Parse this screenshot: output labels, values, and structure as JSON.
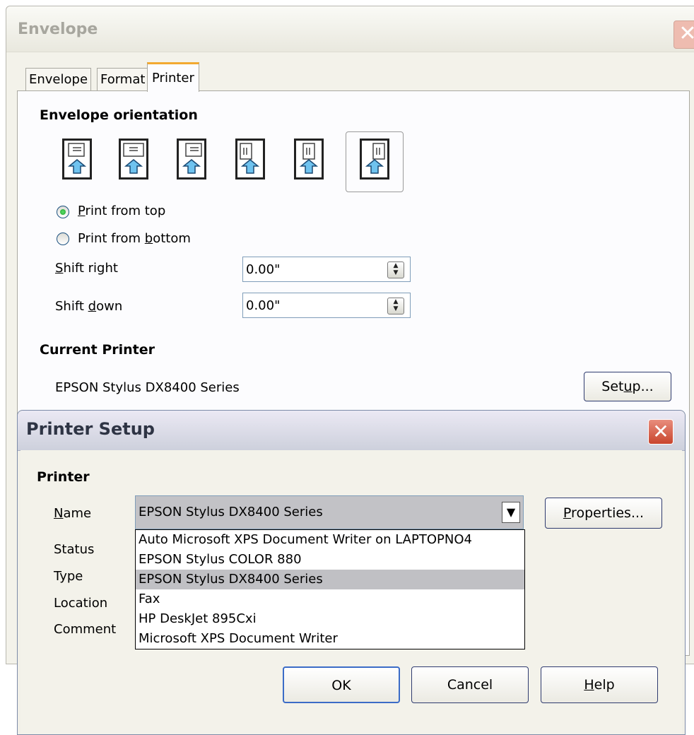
{
  "envelope_dialog": {
    "title": "Envelope",
    "tabs": [
      "Envelope",
      "Format",
      "Printer"
    ],
    "active_tab": "Printer",
    "orientation_heading": "Envelope orientation",
    "orientation_icons": [
      "horizontal-left",
      "horizontal-center",
      "horizontal-right",
      "vertical-left",
      "vertical-center",
      "vertical-right"
    ],
    "selected_orientation_index": 5,
    "print_from_top": {
      "label_key": "P",
      "label_rest": "rint from top",
      "checked": true
    },
    "print_from_bottom": {
      "label_pre": "Print from ",
      "label_key": "b",
      "label_rest": "ottom",
      "checked": false
    },
    "shift_right": {
      "label_key": "S",
      "label_rest": "hift right",
      "value": "0.00\""
    },
    "shift_down": {
      "label_pre": "Shift ",
      "label_key": "d",
      "label_rest": "own",
      "value": "0.00\""
    },
    "current_printer_heading": "Current Printer",
    "current_printer_name": "EPSON Stylus DX8400 Series",
    "setup_button": {
      "pre": "Set",
      "key": "u",
      "rest": "p..."
    }
  },
  "printer_setup_dialog": {
    "title": "Printer Setup",
    "printer_heading": "Printer",
    "name_label": {
      "key": "N",
      "rest": "ame"
    },
    "name_value": "EPSON Stylus DX8400 Series",
    "status_label": "Status",
    "type_label": "Type",
    "location_label": "Location",
    "comment_label": "Comment",
    "properties_button": {
      "key": "P",
      "rest": "roperties..."
    },
    "printer_options": [
      "Auto Microsoft XPS Document Writer on LAPTOPNO4",
      "EPSON Stylus COLOR 880",
      "EPSON Stylus DX8400 Series",
      "Fax",
      "HP DeskJet 895Cxi",
      "Microsoft XPS Document Writer"
    ],
    "selected_option_index": 2,
    "ok_button": "OK",
    "cancel_button": "Cancel",
    "help_button": {
      "key": "H",
      "rest": "elp"
    }
  }
}
